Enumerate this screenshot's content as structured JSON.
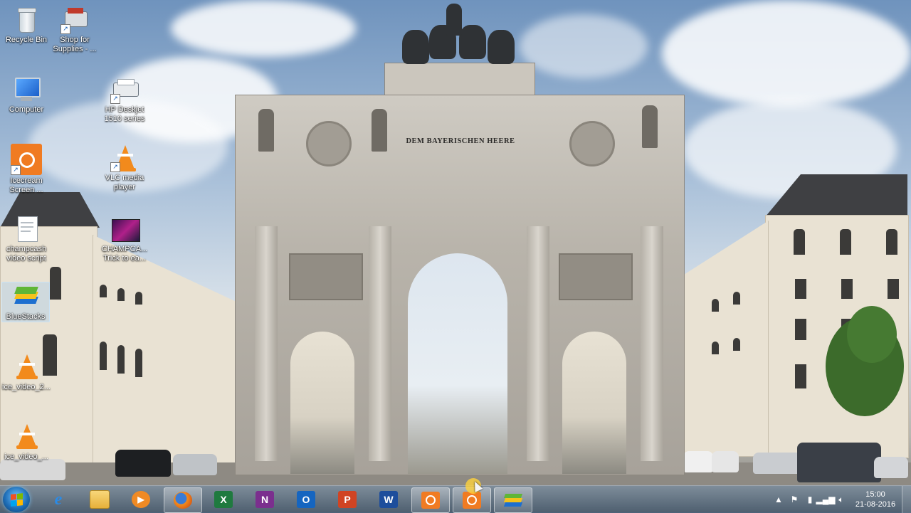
{
  "desktop": {
    "icons": [
      {
        "id": "recycle-bin",
        "label": "Recycle Bin",
        "icon": "recycle-bin-icon"
      },
      {
        "id": "shop-supplies",
        "label": "Shop for Supplies - ...",
        "icon": "printer-shop-icon"
      },
      {
        "id": "computer",
        "label": "Computer",
        "icon": "computer-icon"
      },
      {
        "id": "hp-deskjet",
        "label": "HP Deskjet 1510 series",
        "icon": "printer-icon"
      },
      {
        "id": "icecream",
        "label": "Icecream Screen ...",
        "icon": "icecream-recorder-icon"
      },
      {
        "id": "vlc",
        "label": "VLC media player",
        "icon": "vlc-icon"
      },
      {
        "id": "champcash-script",
        "label": "champcash video script",
        "icon": "text-file-icon"
      },
      {
        "id": "champcash-video",
        "label": "CHAMPCA... Trick to ea...",
        "icon": "video-thumbnail-icon"
      },
      {
        "id": "bluestacks",
        "label": "BlueStacks",
        "icon": "bluestacks-icon"
      },
      {
        "id": "ice-video-2",
        "label": "ice_video_2...",
        "icon": "vlc-file-icon"
      },
      {
        "id": "ice-video",
        "label": "ice_video_...",
        "icon": "vlc-file-icon"
      }
    ],
    "wallpaper": {
      "inscription": "DEM BAYERISCHEN HEERE"
    }
  },
  "taskbar": {
    "start_icon": "windows-start-icon",
    "apps": [
      {
        "id": "ie",
        "icon": "internet-explorer-icon",
        "glyph": "e",
        "color": "#1e88e5"
      },
      {
        "id": "explorer",
        "icon": "folder-icon",
        "glyph": "",
        "color": "#f2c14e"
      },
      {
        "id": "media-player",
        "icon": "media-player-icon",
        "glyph": "▶",
        "color": "#f08a24"
      },
      {
        "id": "firefox",
        "icon": "firefox-icon",
        "glyph": "",
        "color": "#e66000"
      },
      {
        "id": "excel",
        "icon": "excel-icon",
        "glyph": "X",
        "color": "#1f7a3f"
      },
      {
        "id": "onenote",
        "icon": "onenote-icon",
        "glyph": "N",
        "color": "#7b2f8e"
      },
      {
        "id": "outlook",
        "icon": "outlook-icon",
        "glyph": "O",
        "color": "#1565c0"
      },
      {
        "id": "powerpoint",
        "icon": "powerpoint-icon",
        "glyph": "P",
        "color": "#d04423"
      },
      {
        "id": "word",
        "icon": "word-icon",
        "glyph": "W",
        "color": "#1e4e9c"
      },
      {
        "id": "icecream1",
        "icon": "icecream-recorder-icon",
        "glyph": "",
        "color": "#f08a24"
      },
      {
        "id": "icecream2",
        "icon": "icecream-recorder-icon",
        "glyph": "",
        "color": "#f08a24"
      },
      {
        "id": "bluestacks",
        "icon": "bluestacks-icon",
        "glyph": "",
        "color": "#5fb636"
      }
    ],
    "clock": {
      "time": "15:00",
      "date": "21-08-2016"
    },
    "tray_icons": [
      "show-hidden-icons-icon",
      "action-center-flag-icon",
      "power-icon",
      "network-signal-icon",
      "volume-icon"
    ]
  }
}
